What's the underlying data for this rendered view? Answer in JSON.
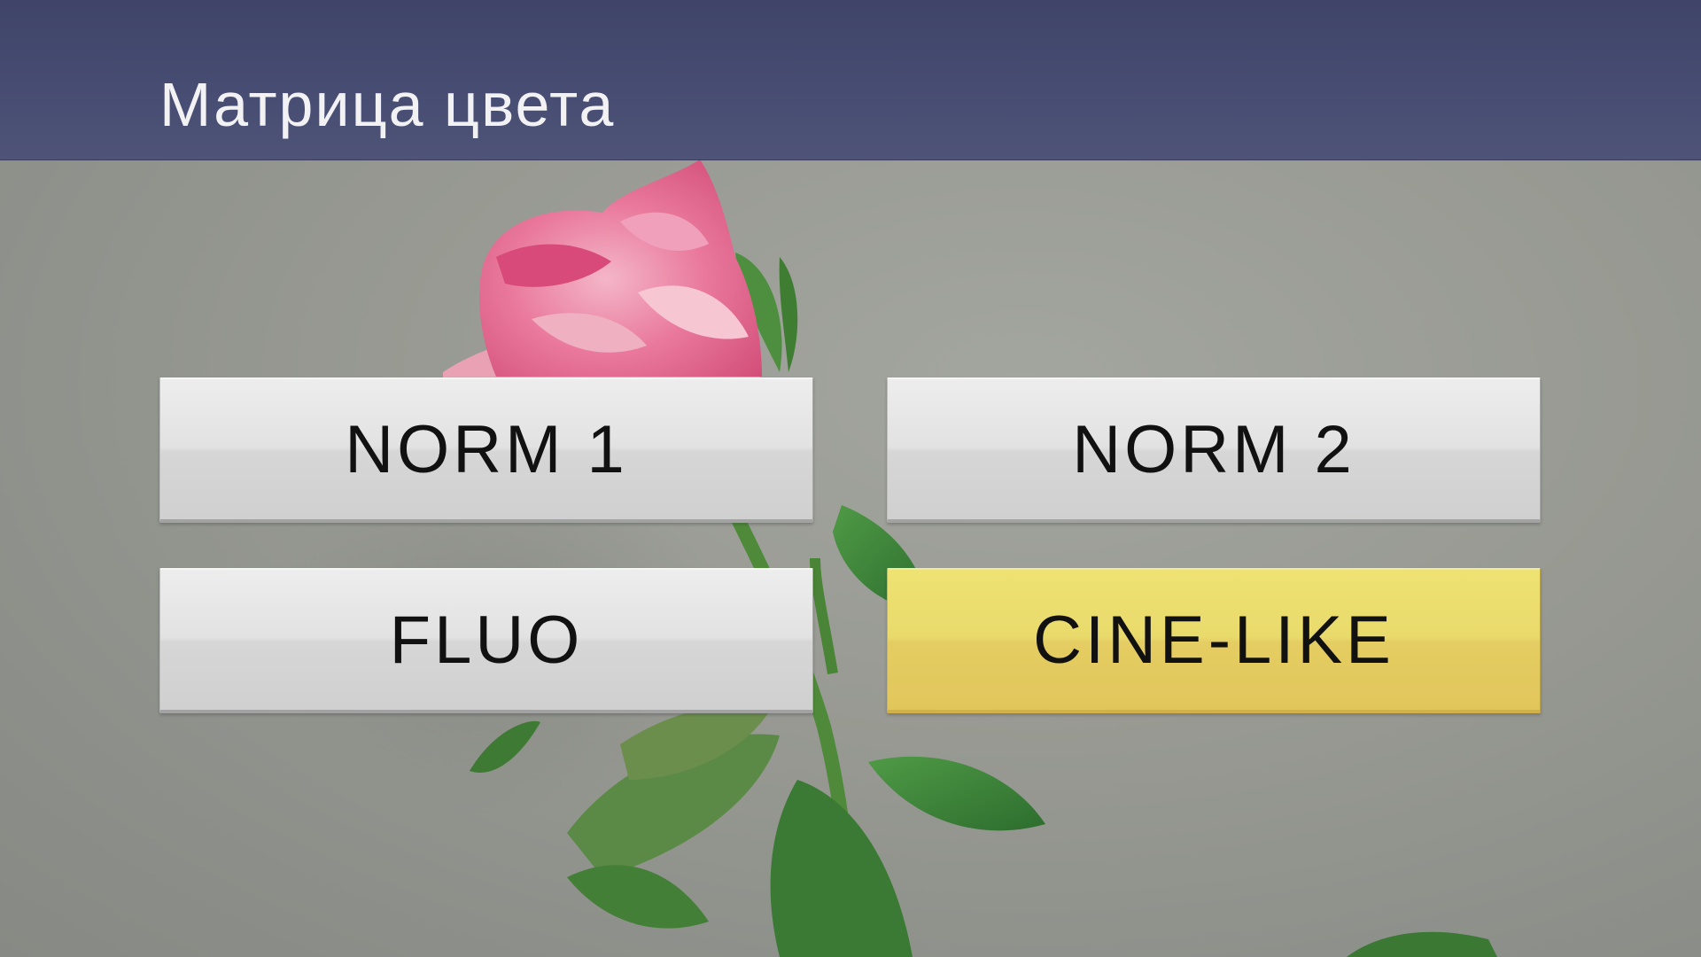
{
  "header": {
    "title": "Матрица цвета"
  },
  "options": [
    {
      "label": "NORM 1",
      "selected": false
    },
    {
      "label": "NORM 2",
      "selected": false
    },
    {
      "label": "FLUO",
      "selected": false
    },
    {
      "label": "CINE-LIKE",
      "selected": true
    }
  ],
  "colors": {
    "title_bar": "#474c72",
    "title_text": "#f2f2f4",
    "option_bg": "#e0e0e0",
    "selected_bg": "#e8d66a",
    "background": "#999b95"
  },
  "background_image": "pink-rose-photo"
}
